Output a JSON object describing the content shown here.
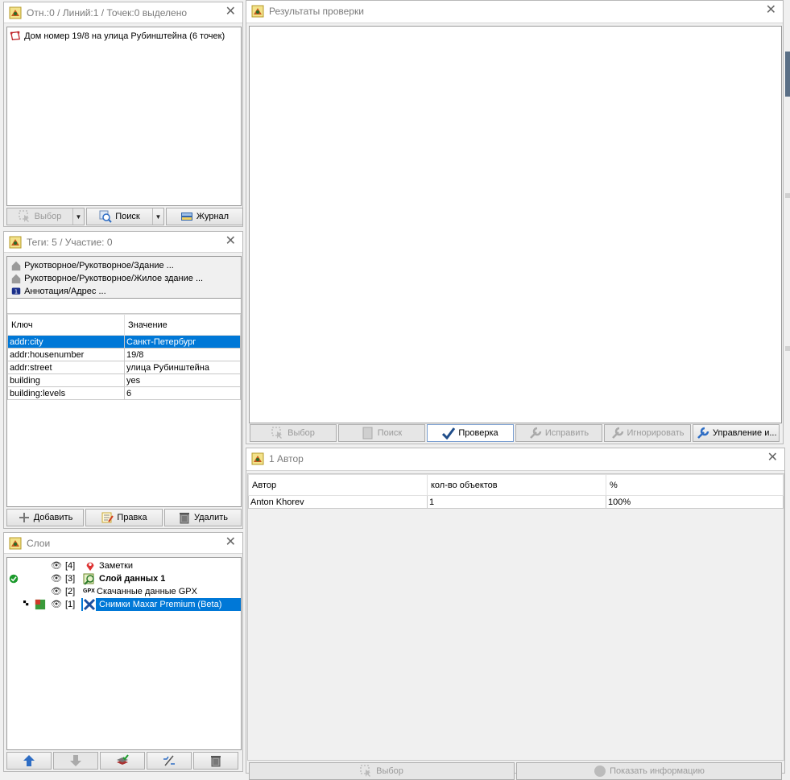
{
  "selection_panel": {
    "title": "Отн.:0 / Линий:1 / Точек:0 выделено",
    "items": [
      "Дом номер 19/8 на улица Рубинштейна (6 точек)"
    ],
    "buttons": {
      "select": "Выбор",
      "search": "Поиск",
      "history": "Журнал"
    }
  },
  "tags_panel": {
    "title": "Теги: 5 / Участие: 0",
    "presets": [
      "Рукотворное/Рукотворное/Здание ...",
      "Рукотворное/Рукотворное/Жилое здание ...",
      "Аннотация/Адрес ..."
    ],
    "columns": {
      "key": "Ключ",
      "value": "Значение"
    },
    "rows": [
      {
        "key": "addr:city",
        "value": "Санкт-Петербург"
      },
      {
        "key": "addr:housenumber",
        "value": "19/8"
      },
      {
        "key": "addr:street",
        "value": "улица Рубинштейна"
      },
      {
        "key": "building",
        "value": "yes"
      },
      {
        "key": "building:levels",
        "value": "6"
      }
    ],
    "buttons": {
      "add": "Добавить",
      "edit": "Правка",
      "delete": "Удалить"
    }
  },
  "layers_panel": {
    "title": "Слои",
    "layers": [
      {
        "index": "[4]",
        "name": "Заметки",
        "icon": "note-pin-icon"
      },
      {
        "index": "[3]",
        "name": "Слой данных 1",
        "icon": "data-layer-icon"
      },
      {
        "index": "[2]",
        "name": "Скачанные данные GPX",
        "icon": "gpx-icon",
        "badge": "GPX"
      },
      {
        "index": "[1]",
        "name": "Снимки Maxar Premium (Beta)",
        "icon": "maxar-icon"
      }
    ]
  },
  "validation_panel": {
    "title": "Результаты проверки",
    "buttons": {
      "select": "Выбор",
      "search": "Поиск",
      "validate": "Проверка",
      "fix": "Исправить",
      "ignore": "Игнорировать",
      "manage": "Управление и..."
    }
  },
  "authors_panel": {
    "title": "1 Автор",
    "columns": {
      "author": "Автор",
      "count": "кол-во объектов",
      "percent": "%"
    },
    "rows": [
      {
        "author": "Anton Khorev",
        "count": "1",
        "percent": "100%"
      }
    ],
    "buttons": {
      "select": "Выбор",
      "info": "Показать информацию"
    }
  },
  "colors": {
    "selection": "#0078d7",
    "active_tick": "#1c9a2c",
    "up_arrow": "#2e6dc4"
  }
}
